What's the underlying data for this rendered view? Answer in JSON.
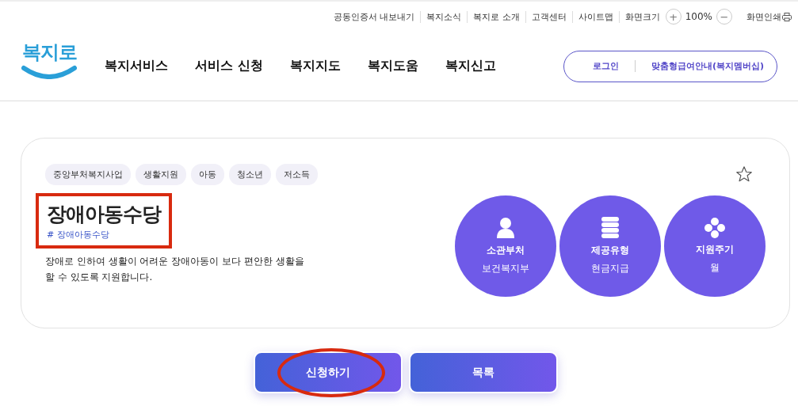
{
  "utility_links": [
    "공동인증서 내보내기",
    "복지소식",
    "복지로 소개",
    "고객센터",
    "사이트맵",
    "화면크기"
  ],
  "zoom": {
    "plus": "+",
    "value": "100%",
    "minus": "−"
  },
  "print": {
    "label": "화면인쇄"
  },
  "logo": {
    "text": "복지로"
  },
  "nav": [
    "복지서비스",
    "서비스 신청",
    "복지지도",
    "복지도움",
    "복지신고"
  ],
  "account": [
    "로그인",
    "맞춤형급여안내(복지멤버십)"
  ],
  "service": {
    "tags": [
      "중앙부처복지사업",
      "생활지원",
      "아동",
      "청소년",
      "저소득"
    ],
    "favorite": false,
    "title": "장애아동수당",
    "hashtag": "# 장애아동수당",
    "title_highlighted": true,
    "description": "장애로 인하여 생활이 어려운 장애아동이 보다 편안한 생활을 할 수 있도록 지원합니다.",
    "facts": [
      {
        "kind": "person",
        "label": "소관부처",
        "value": "보건복지부"
      },
      {
        "kind": "stack",
        "label": "제공유형",
        "value": "현금지급"
      },
      {
        "kind": "dots",
        "label": "지원주기",
        "value": "월"
      }
    ]
  },
  "buttons": [
    {
      "label": "신청하기",
      "highlighted": true
    },
    {
      "label": "목록",
      "highlighted": false
    }
  ]
}
